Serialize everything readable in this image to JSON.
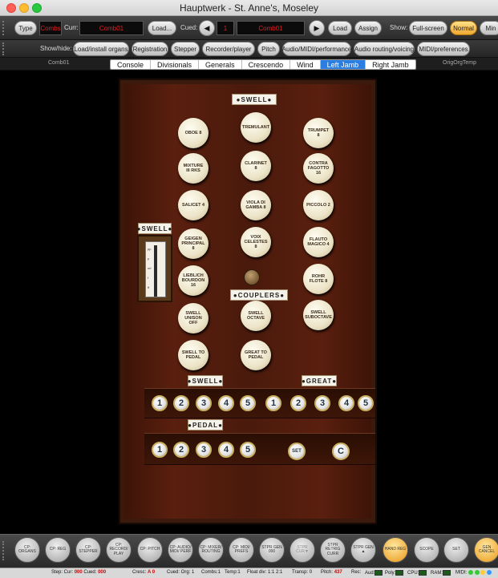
{
  "window": {
    "title": "Hauptwerk - St. Anne's, Moseley"
  },
  "toolbar1": {
    "type_btn": "Type",
    "combs_value": "Combs",
    "curr_label": "Curr:",
    "curr_value": "Comb01",
    "load_btn": "Load...",
    "cued_label": "Cued:",
    "prev_icon": "triangle-left",
    "cued_number": "1",
    "cued_value": "Comb01",
    "next_icon": "triangle-right",
    "load2_btn": "Load",
    "assign_btn": "Assign",
    "show_label": "Show:",
    "fullscreen_btn": "Full-screen",
    "normal_btn": "Normal",
    "min_btn": "Min"
  },
  "toolbar2": {
    "showhide_label": "Show/hide:",
    "buttons": [
      "Load/install organs",
      "Registration",
      "Stepper",
      "Recorder/player",
      "Pitch",
      "Audio/MIDI/performance",
      "Audio routing/voicing",
      "MIDI/preferences"
    ]
  },
  "tabbar": {
    "left_label": "Comb01",
    "right_label": "OrigOrgTemp",
    "tabs": [
      "Console",
      "Divisionals",
      "Generals",
      "Crescendo",
      "Wind",
      "Left Jamb",
      "Right Jamb"
    ],
    "selected": "Left Jamb"
  },
  "jamb": {
    "swell_plaque": "SWELL",
    "couplers_plaque": "COUPLERS",
    "pedal_box_plaque": "SWELL",
    "pedal_box_marks": [
      "pp",
      "p",
      "mf",
      "f",
      "ff"
    ],
    "stops": {
      "oboe": "OBOE 8",
      "tremulant": "TREMULANT",
      "trumpet": "TRUMPET 8",
      "mixture": "MIXTURE III RKS",
      "clarinet": "CLARINET 8",
      "contra_fagotto": "CONTRA FAGOTTO 16",
      "salicet": "SALICET 4",
      "viola_di_gamba": "VIOLA DI GAMBA 8",
      "piccolo": "PICCOLO 2",
      "geigen_principal": "GEIGEN PRINCIPAL 8",
      "voix_celestes": "VOIX CELESTES 8",
      "flauto_magico": "FLAUTO MAGICO 4",
      "lieblich_bourdon": "LIEBLICH BOURDON 16",
      "rohr_flote": "ROHR FLOTE 8",
      "swell_unison_off": "SWELL UNISON OFF",
      "swell_octave": "SWELL OCTAVE",
      "swell_suboctave": "SWELL SUBOCTAVE",
      "swell_to_pedal": "SWELL TO PEDAL",
      "great_to_pedal": "GREAT TO PEDAL"
    },
    "pistons": {
      "swell_label": "SWELL",
      "great_label": "GREAT",
      "pedal_label": "PEDAL",
      "swell": [
        "1",
        "2",
        "3",
        "4",
        "5"
      ],
      "great": [
        "1",
        "2",
        "3",
        "4",
        "5"
      ],
      "pedal": [
        "1",
        "2",
        "3",
        "4",
        "5"
      ],
      "set": "SET",
      "cancel": "C"
    }
  },
  "bottombar": {
    "buttons": [
      "CP: ORGANS",
      "CP: REG",
      "CP: STEPPER",
      "CP: RECORD/ PLAY",
      "CP: PITCH",
      "CP: AUDIO/ MIDI/ PERF",
      "CP: MIXER/ ROUTING",
      "CP: MIDI/ PREFS",
      "STPR GEN 000",
      "STPR CUR▼",
      "STPR RETRIG CURR",
      "STPR GEN ▲",
      "HAND REG",
      "SCOPE",
      "SET",
      "GEN CANCEL"
    ]
  },
  "status": {
    "step_cur_label": "Step: Cur:",
    "step_cur": "000",
    "cued_label": "Cued:",
    "cued": "000",
    "cresc_label": "Cresc:",
    "cresc": "A 0",
    "cued_org_label": "Cued: Org:",
    "cued_org": "1",
    "combs_label": "Combs:",
    "combs": "1",
    "temp_label": "Temp:",
    "temp": "1",
    "float_div_label": "Float div:",
    "float_div": "1:1 2:1",
    "transp_label": "Transp:",
    "transp": "0",
    "pitch_label": "Pitch:",
    "pitch": "437",
    "rec_label": "Rec:",
    "aud_label": "Aud:",
    "poly_label": "Poly:",
    "cpu_label": "CPU:",
    "ram_label": "RAM:",
    "midi_label": "MIDI:"
  },
  "colors": {
    "accent_blue": "#2a7de1",
    "combs_red": "#e02020",
    "normal_gold": "#f0a830"
  }
}
